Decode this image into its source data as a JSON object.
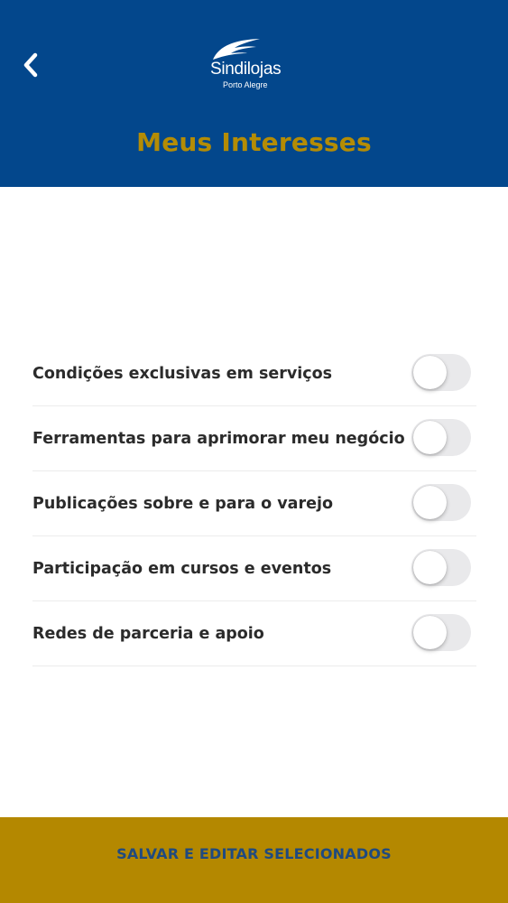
{
  "header": {
    "back_icon": "chevron-left-icon",
    "logo": {
      "name": "Sindilojas",
      "subtitle": "Porto Alegre"
    },
    "title": "Meus Interesses"
  },
  "interests": [
    {
      "label": "Condições exclusivas em serviços",
      "enabled": false
    },
    {
      "label": "Ferramentas para aprimorar meu negócio",
      "enabled": false
    },
    {
      "label": "Publicações sobre e para o varejo",
      "enabled": false
    },
    {
      "label": "Participação em cursos e eventos",
      "enabled": false
    },
    {
      "label": "Redes de parceria e apoio",
      "enabled": false
    }
  ],
  "footer": {
    "button_label": "SALVAR E EDITAR SELECIONADOS"
  },
  "colors": {
    "header_bg": "#03478c",
    "title": "#b48c05",
    "footer_bg": "#b48800",
    "footer_text": "#1f4a80",
    "toggle_off": "#e9e9eb"
  }
}
